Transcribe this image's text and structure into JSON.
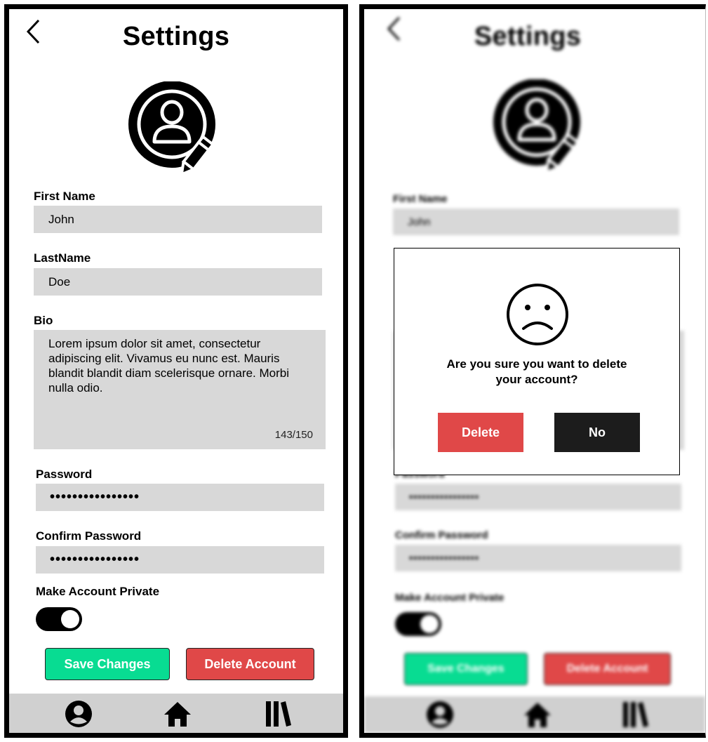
{
  "screens": [
    {
      "title": "Settings",
      "fields": {
        "first_name": {
          "label": "First Name",
          "value": "John"
        },
        "last_name": {
          "label": "LastName",
          "value": "Doe"
        },
        "bio": {
          "label": "Bio",
          "value": "Lorem ipsum dolor sit amet, consectetur adipiscing elit. Vivamus eu nunc est. Mauris blandit blandit diam scelerisque ornare. Morbi nulla odio.",
          "counter": "143/150"
        },
        "password": {
          "label": "Password",
          "value": "••••••••••••••••"
        },
        "confirm_password": {
          "label": "Confirm Password",
          "value": "••••••••••••••••"
        }
      },
      "private_toggle": {
        "label": "Make Account Private",
        "on": true
      },
      "buttons": {
        "save": "Save Changes",
        "delete": "Delete Account"
      },
      "nav": [
        "user-circle-icon",
        "home-icon",
        "library-icon"
      ]
    },
    {
      "title": "Settings",
      "fields": {
        "first_name": {
          "label": "First Name",
          "value": "John"
        },
        "password": {
          "label": "Password",
          "value": "••••••••••••••••"
        },
        "confirm_password": {
          "label": "Confirm Password",
          "value": "••••••••••••••••"
        }
      },
      "private_toggle": {
        "label": "Make Account Private",
        "on": true
      },
      "buttons": {
        "save": "Save Changes",
        "delete": "Delete Account"
      },
      "modal": {
        "icon": "sad-face-icon",
        "message": "Are you sure you want to delete your account?",
        "delete_label": "Delete",
        "no_label": "No"
      }
    }
  ],
  "colors": {
    "save_green": "#08dc92",
    "delete_red": "#e04848",
    "field_gray": "#d8d8d8",
    "nav_gray": "#d0d0d0",
    "no_dark": "#1c1c1c"
  }
}
